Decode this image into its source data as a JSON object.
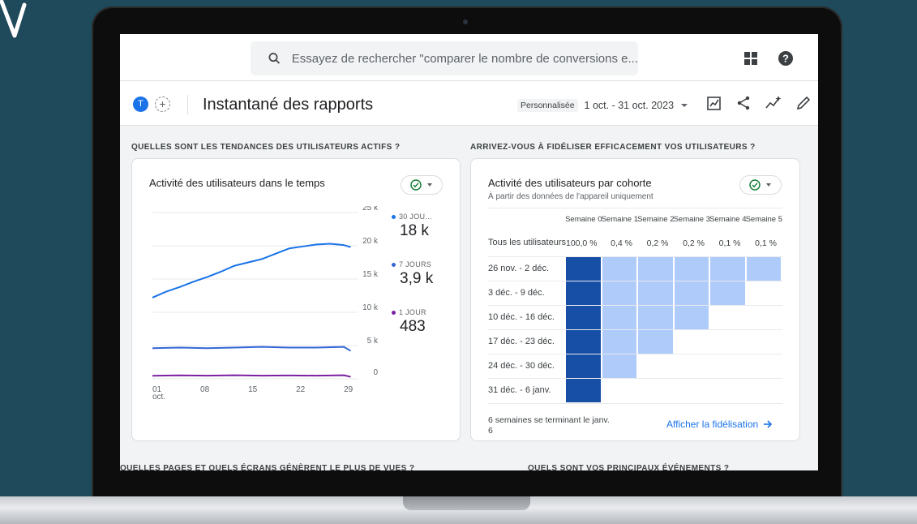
{
  "search": {
    "placeholder": "Essayez de rechercher \"comparer le nombre de conversions e..."
  },
  "top_icons": [
    "apps-grid-icon",
    "help-icon"
  ],
  "header": {
    "avatar_letter": "T",
    "title": "Instantané des rapports",
    "date_badge": "Personnalisée",
    "date_range": "1 oct. - 31 oct. 2023",
    "icons": [
      "customize-report-icon",
      "share-icon",
      "insights-icon",
      "edit-icon"
    ]
  },
  "sections": {
    "left_title": "QUELLES SONT LES TENDANCES DES UTILISATEURS ACTIFS ?",
    "right_title": "ARRIVEZ-VOUS À FIDÉLISER EFFICACEMENT VOS UTILISATEURS ?",
    "bottom_left_title": "QUELLES PAGES ET QUELS ÉCRANS GÉNÈRENT LE PLUS DE VUES ?",
    "bottom_right_title": "QUELS SONT VOS PRINCIPAUX ÉVÉNEMENTS ?"
  },
  "activity_card": {
    "title": "Activité des utilisateurs dans le temps",
    "legend": [
      {
        "label": "30 JOU...",
        "value": "18 k",
        "color": "#1a73e8"
      },
      {
        "label": "7 JOURS",
        "value": "3,9 k",
        "color": "#3367d6"
      },
      {
        "label": "1 JOUR",
        "value": "483",
        "color": "#7b1fa2"
      }
    ]
  },
  "chart_data": {
    "type": "line",
    "x_ticks": [
      "01\noct.",
      "08",
      "15",
      "22",
      "29"
    ],
    "y_ticks": [
      "25 k",
      "20 k",
      "15 k",
      "10 k",
      "5 k",
      "0"
    ],
    "ylim": [
      0,
      25000
    ],
    "xlim": [
      1,
      31
    ],
    "series": [
      {
        "name": "30 JOU...",
        "color": "#1a73e8",
        "x": [
          1,
          3,
          5,
          7,
          9,
          11,
          13,
          15,
          17,
          19,
          21,
          23,
          25,
          27,
          29,
          30
        ],
        "values": [
          12200,
          13100,
          13800,
          14600,
          15300,
          16100,
          17000,
          17500,
          18000,
          18800,
          19600,
          19900,
          20200,
          20300,
          20100,
          19800
        ]
      },
      {
        "name": "7 JOURS",
        "color": "#3367d6",
        "x": [
          1,
          5,
          9,
          13,
          17,
          21,
          25,
          29,
          30
        ],
        "values": [
          4600,
          4700,
          4600,
          4700,
          4800,
          4700,
          4700,
          4800,
          4200
        ]
      },
      {
        "name": "1 JOUR",
        "color": "#7b1fa2",
        "x": [
          1,
          5,
          9,
          13,
          17,
          21,
          25,
          29,
          30
        ],
        "values": [
          460,
          520,
          470,
          540,
          480,
          510,
          470,
          530,
          300
        ]
      }
    ]
  },
  "cohort_card": {
    "title": "Activité des utilisateurs par cohorte",
    "subtitle": "À partir des données de l'appareil uniquement",
    "headers": [
      "Semaine 0",
      "Semaine 1",
      "Semaine 2",
      "Semaine 3",
      "Semaine 4",
      "Semaine 5"
    ],
    "all_users_label": "Tous les utilisateurs",
    "all_users_values": [
      "100,0 %",
      "0,4 %",
      "0,2 %",
      "0,2 %",
      "0,1 %",
      "0,1 %"
    ],
    "rows": [
      {
        "label": "26 nov. - 2 déc.",
        "cells": 6
      },
      {
        "label": "3 déc. - 9 déc.",
        "cells": 5
      },
      {
        "label": "10 déc. - 16 déc.",
        "cells": 4
      },
      {
        "label": "17 déc. - 23 déc.",
        "cells": 3
      },
      {
        "label": "24 déc. - 30 déc.",
        "cells": 2
      },
      {
        "label": "31 déc. - 6 janv.",
        "cells": 1
      }
    ],
    "footnote": "6 semaines se terminant le janv. 6",
    "link_label": "Afficher la fidélisation",
    "colors": {
      "week0": "#174ea6",
      "later": "#aecbfa"
    }
  }
}
